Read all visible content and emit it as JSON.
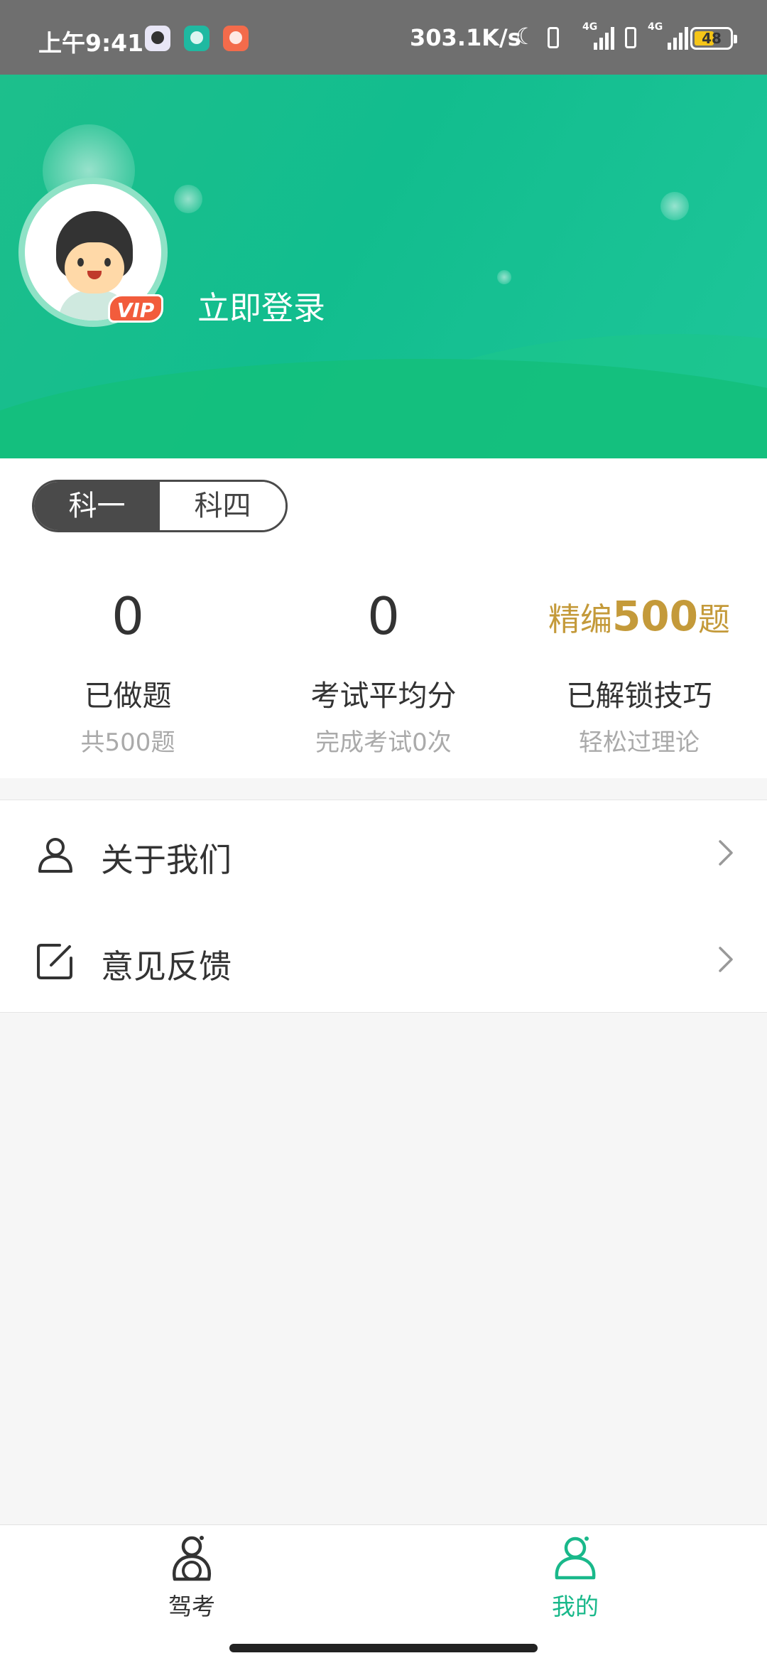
{
  "status_bar": {
    "time": "上午9:41",
    "speed": "303.1K/s",
    "network1": "4G",
    "network2": "4G",
    "battery": "48",
    "icons": [
      "qq-icon",
      "robot-app-icon",
      "mic-app-icon",
      "moon-icon",
      "signal-icon",
      "battery-icon"
    ]
  },
  "header": {
    "login_text": "立即登录",
    "vip_badge": "VIP",
    "accent_color": "#1dbf8c"
  },
  "subject_tabs": [
    {
      "label": "科一",
      "active": true
    },
    {
      "label": "科四",
      "active": false
    }
  ],
  "stats": {
    "done": {
      "value": "0",
      "label": "已做题",
      "sub": "共500题"
    },
    "avg": {
      "value": "0",
      "label": "考试平均分",
      "sub": "完成考试0次"
    },
    "tips": {
      "prefix": "精编",
      "number": "500",
      "suffix": "题",
      "label": "已解锁技巧",
      "sub": "轻松过理论"
    }
  },
  "menu": [
    {
      "label": "关于我们",
      "icon": "person-icon"
    },
    {
      "label": "意见反馈",
      "icon": "edit-icon"
    }
  ],
  "bottom_nav": [
    {
      "label": "驾考",
      "icon": "driver-icon",
      "active": false
    },
    {
      "label": "我的",
      "icon": "profile-icon",
      "active": true
    }
  ]
}
